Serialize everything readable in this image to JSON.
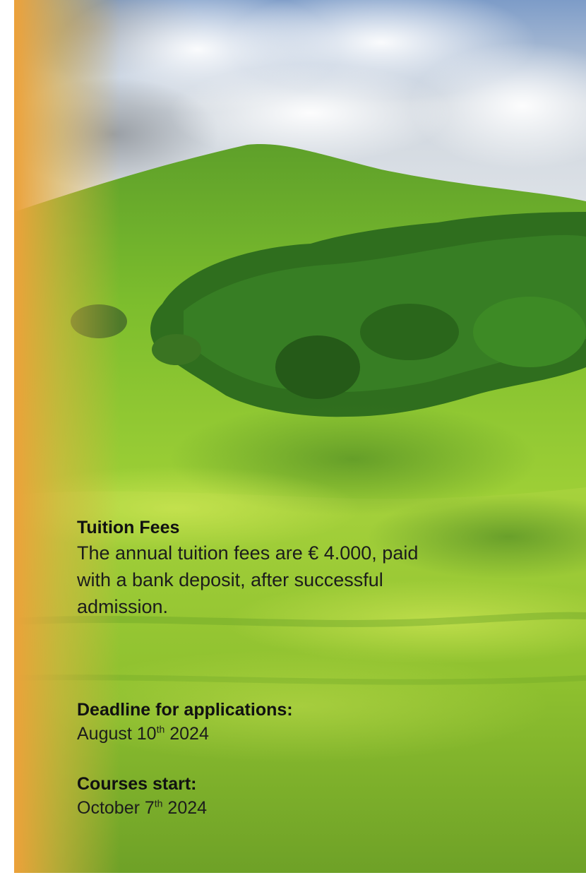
{
  "tuition": {
    "heading": "Tuition Fees",
    "body_line1": "The annual tuition fees are € 4.000, paid",
    "body_line2": "with a bank deposit, after successful",
    "body_line3": "admission."
  },
  "deadline": {
    "heading": "Deadline for applications:",
    "date_prefix": "August 10",
    "date_suffix": "th",
    "date_year": " 2024"
  },
  "courses": {
    "heading": "Courses start:",
    "date_prefix": "October 7",
    "date_suffix": "th",
    "date_year": " 2024"
  },
  "colors": {
    "edge_orange": "#e9a23b",
    "grass_green": "#7fbf2a",
    "forest_green": "#2f6e1e",
    "sky_blue": "#5b86c4"
  }
}
